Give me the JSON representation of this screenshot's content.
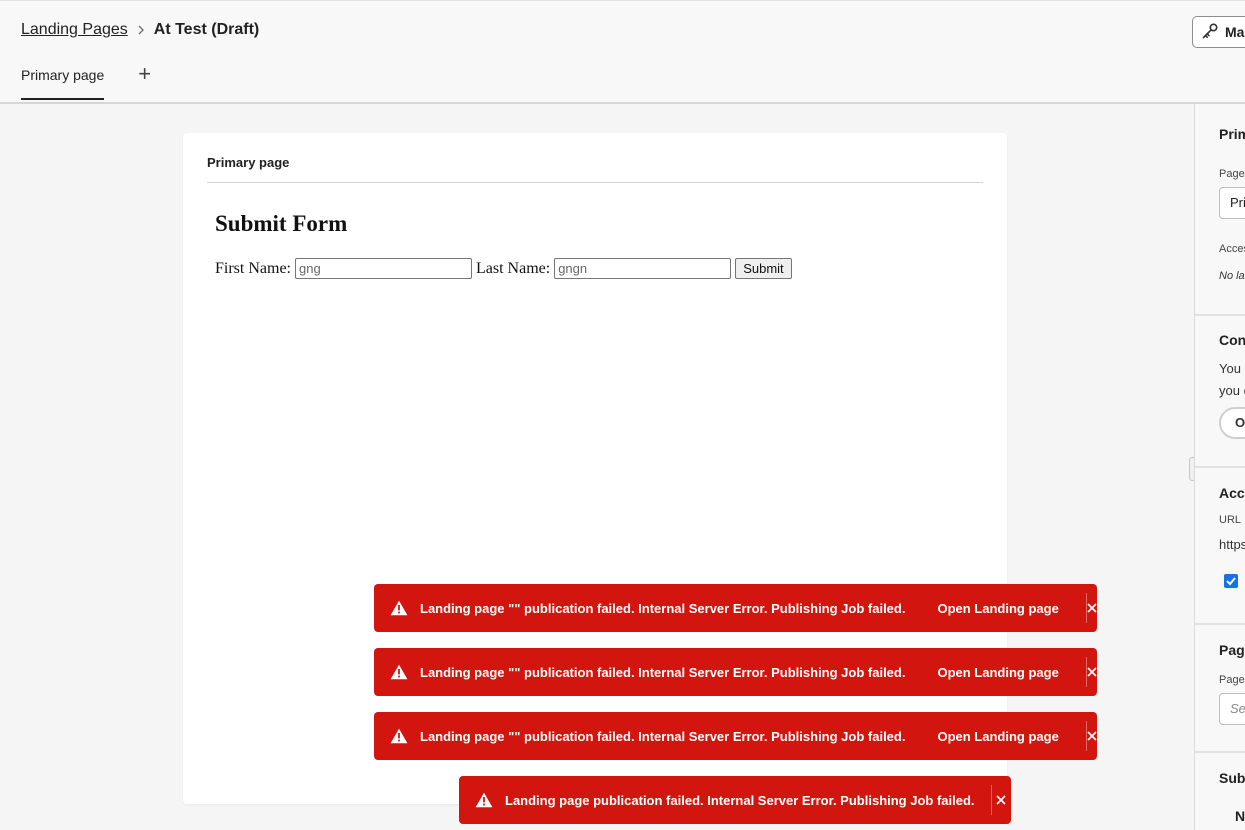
{
  "header": {
    "breadcrumb_root": "Landing Pages",
    "breadcrumb_current": "At Test (Draft)",
    "manage_button_label": "Manage"
  },
  "tabs": {
    "primary_label": "Primary page",
    "add_label": "+"
  },
  "canvas": {
    "title": "Primary page",
    "form_heading": "Submit Form",
    "first_name_label": "First Name:",
    "first_name_value": "gng",
    "last_name_label": "Last Name:",
    "last_name_value": "gngn",
    "submit_label": "Submit"
  },
  "right_panel": {
    "s1_title": "Primary page",
    "s1_field_label": "Page",
    "s1_field_value": "Primary page",
    "s1_access_label": "Access",
    "s1_access_value": "No label",
    "s2_title": "Content",
    "s2_line1": "You can",
    "s2_line2": "you can",
    "s2_button": "Open",
    "s3_title": "Access",
    "s3_url_label": "URL",
    "s3_url_value": "https://",
    "s4_title": "Page",
    "s4_field_label": "Page",
    "s4_placeholder": "Select",
    "s5_title": "Subscription",
    "s5_text": "N"
  },
  "toasts": [
    {
      "message": "Landing page \"\" publication failed. Internal Server Error. Publishing Job failed.",
      "action": "Open Landing page"
    },
    {
      "message": "Landing page \"\" publication failed. Internal Server Error. Publishing Job failed.",
      "action": "Open Landing page"
    },
    {
      "message": "Landing page \"\" publication failed. Internal Server Error. Publishing Job failed.",
      "action": "Open Landing page"
    },
    {
      "message": "Landing page publication failed. Internal Server Error. Publishing Job failed."
    }
  ],
  "colors": {
    "toast_error": "#d31510",
    "accent_blue": "#1473e6"
  }
}
